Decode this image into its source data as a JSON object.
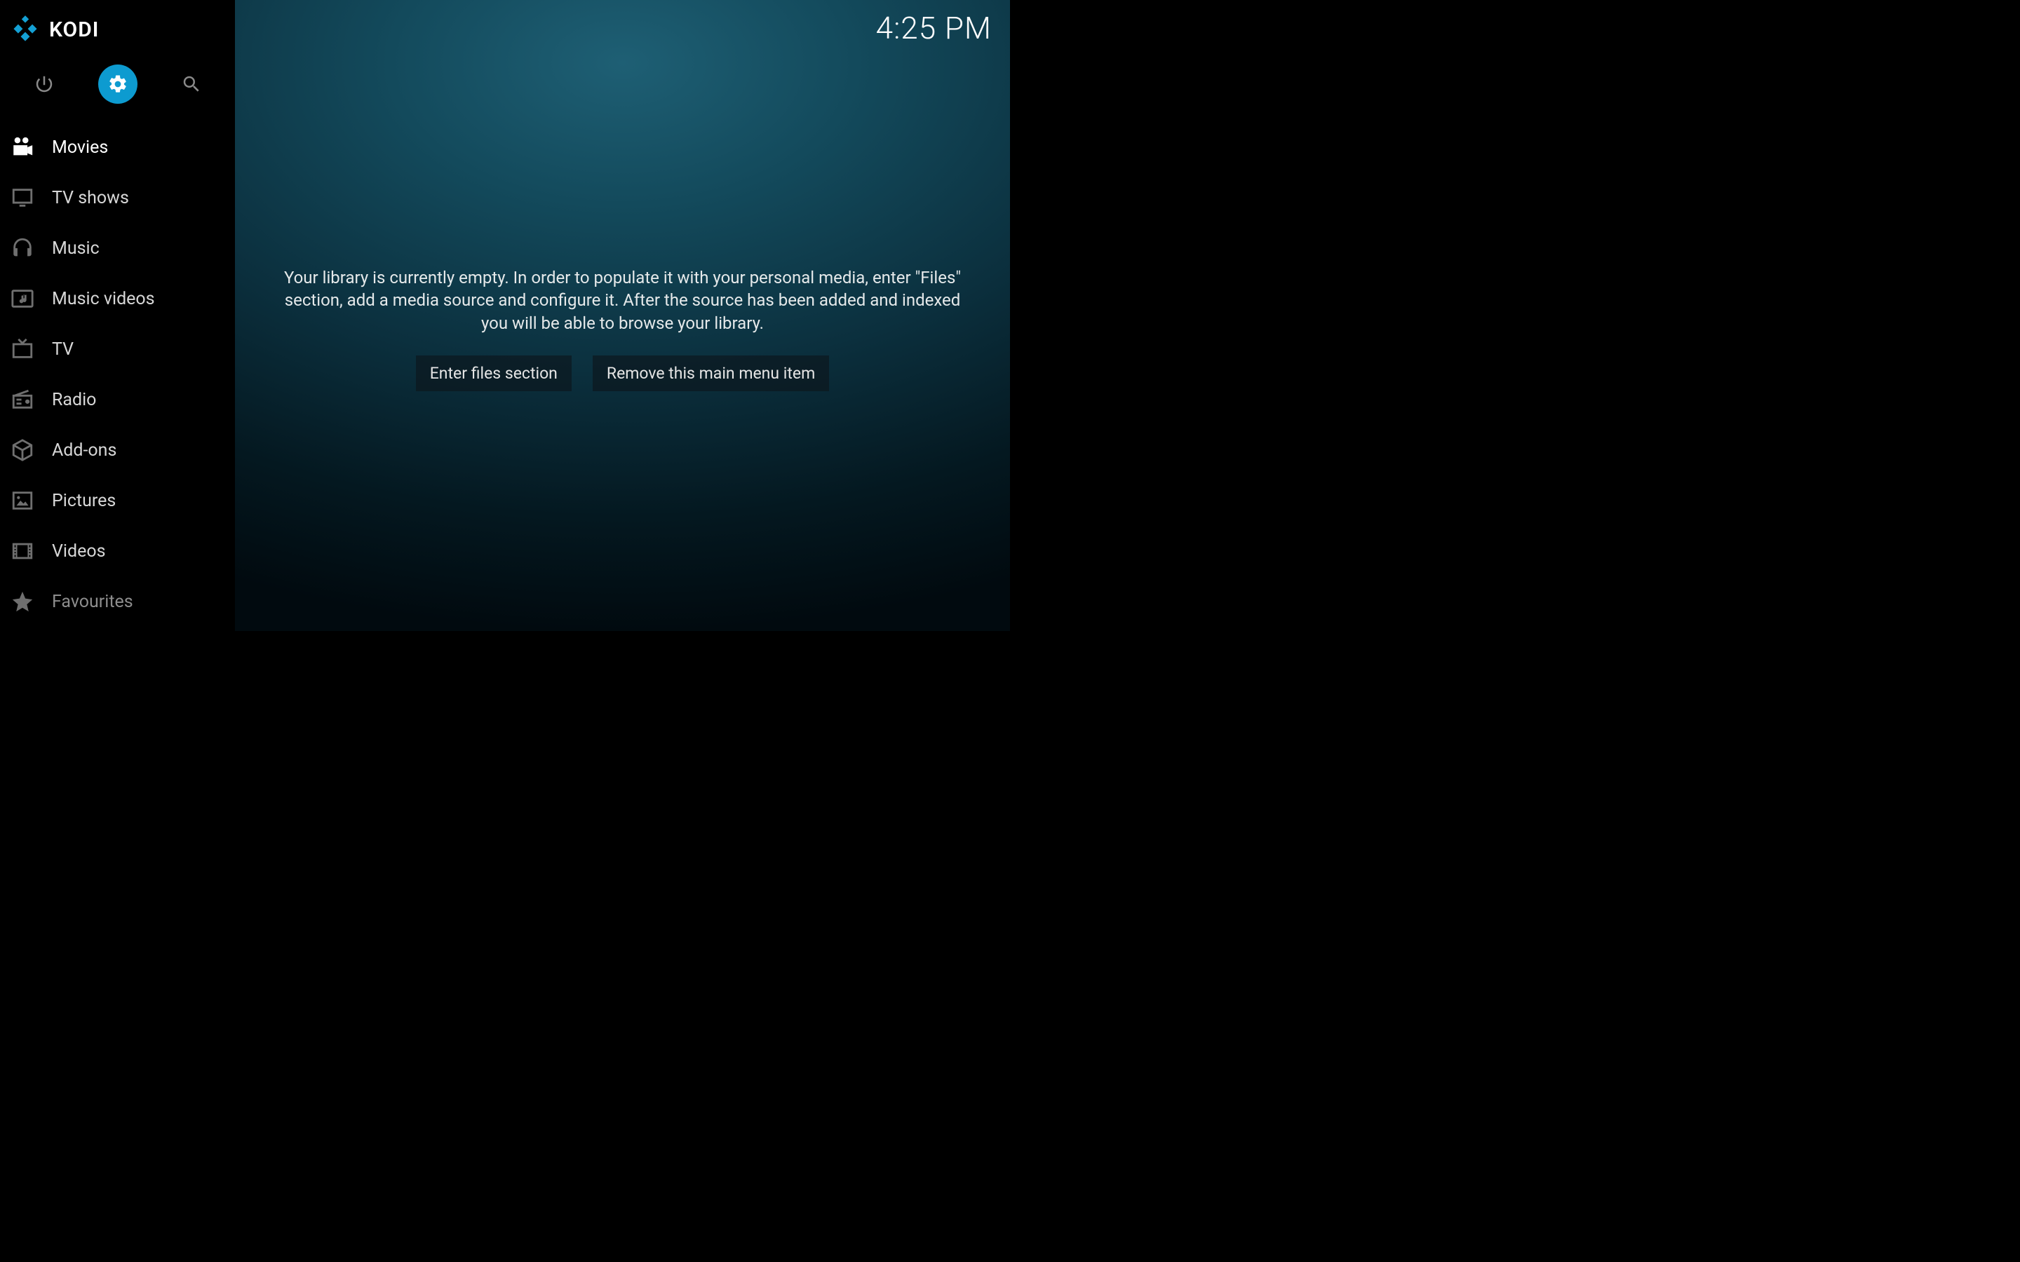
{
  "header": {
    "brand": "KODI",
    "clock": "4:25 PM"
  },
  "topbar": {
    "power": "power",
    "settings": "settings",
    "search": "search"
  },
  "sidebar": {
    "items": [
      {
        "icon": "movie-camera-icon",
        "label": "Movies",
        "active": true
      },
      {
        "icon": "tv-monitor-icon",
        "label": "TV shows"
      },
      {
        "icon": "headphones-icon",
        "label": "Music"
      },
      {
        "icon": "music-video-icon",
        "label": "Music videos"
      },
      {
        "icon": "live-tv-icon",
        "label": "TV"
      },
      {
        "icon": "radio-icon",
        "label": "Radio"
      },
      {
        "icon": "addons-box-icon",
        "label": "Add-ons"
      },
      {
        "icon": "picture-frame-icon",
        "label": "Pictures"
      },
      {
        "icon": "film-strip-icon",
        "label": "Videos"
      },
      {
        "icon": "star-icon",
        "label": "Favourites",
        "faded": true
      }
    ]
  },
  "main": {
    "empty_message": "Your library is currently empty. In order to populate it with your personal media, enter \"Files\" section, add a media source and configure it. After the source has been added and indexed you will be able to browse your library.",
    "buttons": {
      "enter_files": "Enter files section",
      "remove_item": "Remove this main menu item"
    }
  }
}
